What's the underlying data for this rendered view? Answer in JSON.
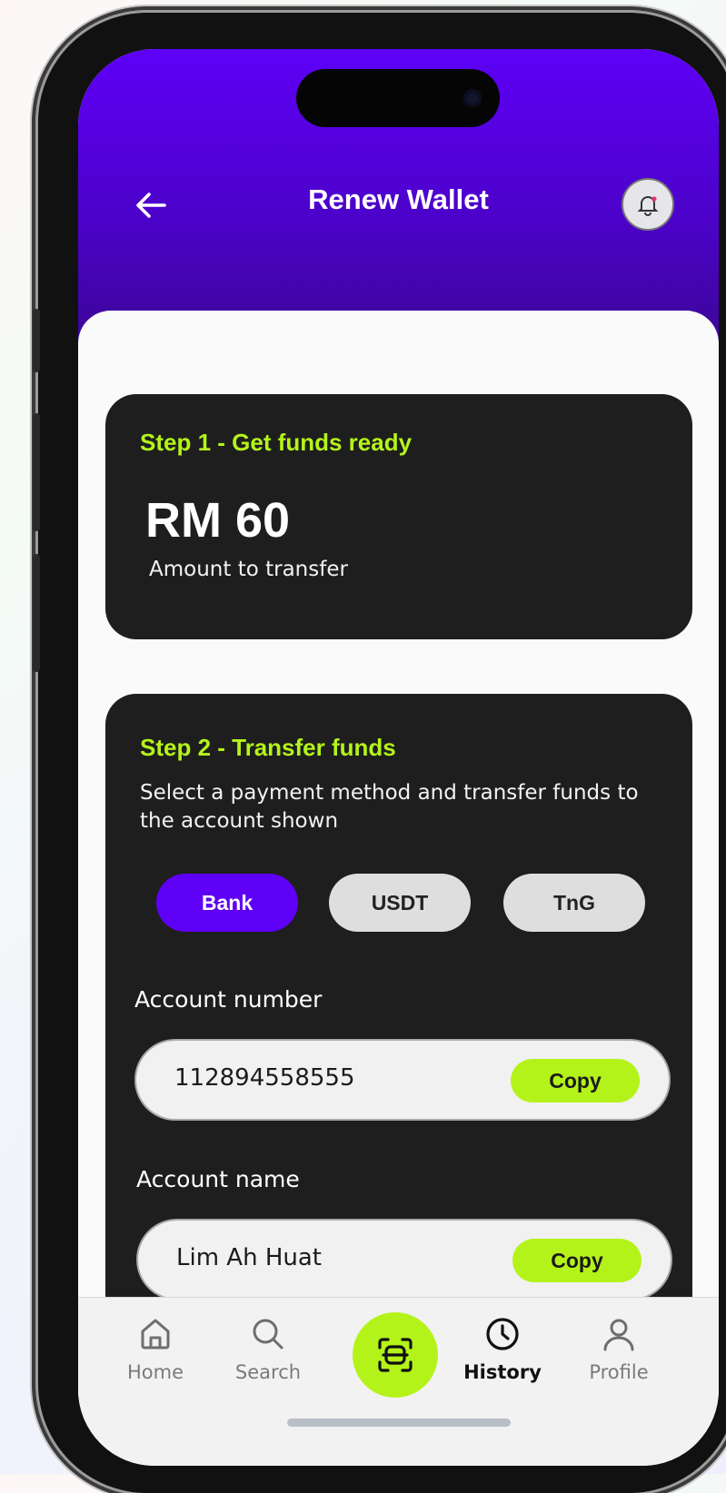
{
  "header": {
    "title": "Renew Wallet",
    "back_icon": "arrow-left-icon",
    "notification_icon": "bell-icon"
  },
  "step1": {
    "title": "Step 1 - Get funds ready",
    "amount": "RM 60",
    "amount_label": "Amount to transfer"
  },
  "step2": {
    "title": "Step 2 - Transfer funds",
    "description": "Select a payment method and transfer funds to the account shown",
    "methods": [
      {
        "label": "Bank",
        "selected": true
      },
      {
        "label": "USDT",
        "selected": false
      },
      {
        "label": "TnG",
        "selected": false
      }
    ],
    "account_number_label": "Account number",
    "account_number": "112894558555",
    "account_name_label": "Account name",
    "account_name": "Lim Ah Huat",
    "copy_label": "Copy"
  },
  "tabbar": {
    "items": [
      {
        "label": "Home",
        "icon": "home-icon",
        "active": false
      },
      {
        "label": "Search",
        "icon": "search-icon",
        "active": false
      },
      {
        "label": "",
        "icon": "scan-icon",
        "active": false
      },
      {
        "label": "History",
        "icon": "clock-icon",
        "active": true
      },
      {
        "label": "Profile",
        "icon": "user-icon",
        "active": false
      }
    ]
  },
  "colors": {
    "brand_purple": "#5e00f6",
    "accent_lime": "#b4f31a",
    "card_dark": "#1e1e1e"
  }
}
